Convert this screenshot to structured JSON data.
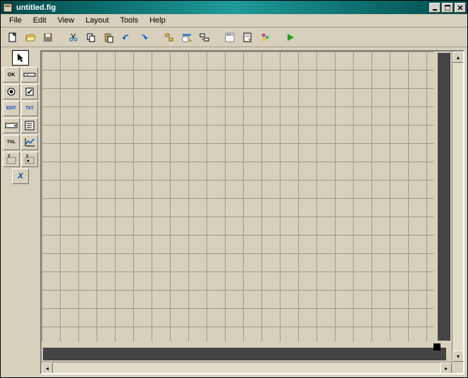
{
  "window": {
    "title": "untitled.fig"
  },
  "menubar": {
    "items": [
      "File",
      "Edit",
      "View",
      "Layout",
      "Tools",
      "Help"
    ]
  },
  "toolbar": {
    "buttons": [
      {
        "name": "new-icon"
      },
      {
        "name": "open-icon"
      },
      {
        "name": "save-icon"
      },
      {
        "sep": true
      },
      {
        "name": "cut-icon"
      },
      {
        "name": "copy-icon"
      },
      {
        "name": "paste-icon"
      },
      {
        "name": "undo-icon"
      },
      {
        "name": "redo-icon"
      },
      {
        "sep": true
      },
      {
        "name": "align-icon"
      },
      {
        "name": "menu-editor-icon"
      },
      {
        "name": "tab-order-icon"
      },
      {
        "sep": true
      },
      {
        "name": "toolbar-editor-icon"
      },
      {
        "name": "mfile-editor-icon"
      },
      {
        "name": "property-inspector-icon"
      },
      {
        "sep": true
      },
      {
        "name": "run-icon"
      }
    ]
  },
  "palette": {
    "pointer_label": "",
    "rows": [
      [
        {
          "label": "OK",
          "name": "pushbutton-tool"
        },
        {
          "label": "▭▭▭",
          "name": "slider-tool"
        }
      ],
      [
        {
          "label": "◉",
          "name": "radiobutton-tool"
        },
        {
          "label": "☑",
          "name": "checkbox-tool"
        }
      ],
      [
        {
          "label": "EDIT",
          "name": "edittext-tool"
        },
        {
          "label": "TXT",
          "name": "statictext-tool"
        }
      ],
      [
        {
          "label": "▭▾",
          "name": "popupmenu-tool"
        },
        {
          "label": "≡",
          "name": "listbox-tool"
        }
      ],
      [
        {
          "label": "TGL",
          "name": "togglebutton-tool"
        },
        {
          "label": "📈",
          "name": "axes-tool"
        }
      ],
      [
        {
          "label": "T▭",
          "name": "panel-tool"
        },
        {
          "label": "T▭",
          "name": "buttongroup-tool"
        }
      ],
      [
        {
          "label": "X",
          "name": "activex-tool"
        }
      ]
    ]
  }
}
